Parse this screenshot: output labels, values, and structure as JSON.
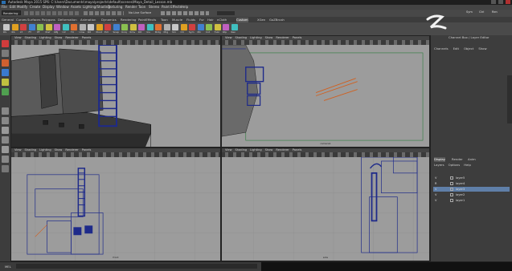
{
  "window": {
    "title": "Autodesk Maya 2015 SP6: C:\\Users\\Documents\\maya\\projects\\default\\scenes\\Maya_Detail_Lesson.mb"
  },
  "menubar": {
    "items": [
      "File",
      "Edit",
      "Modify",
      "Create",
      "Display",
      "Window",
      "Assets",
      "Lighting/Shading",
      "Texturing",
      "Render",
      "Toon",
      "Stereo",
      "Paint Effects",
      "Help"
    ]
  },
  "statusline": {
    "mode": "Rendering",
    "field": "No Live Surface",
    "tabs": [
      "Sym",
      "Ctrl",
      "Ren"
    ]
  },
  "shelf": {
    "tabs": [
      "General",
      "Curves",
      "Surfaces",
      "Polygons",
      "Deformation",
      "Animation",
      "Dynamics",
      "Rendering",
      "PaintEffects",
      "Toon",
      "Muscle",
      "Fluids",
      "Fur",
      "Hair",
      "nCloth",
      "Custom",
      "XGen",
      "GoZBrush"
    ],
    "active_tab": "Custom",
    "buttons": [
      "RS",
      "RS",
      "LT",
      "FT",
      "PF",
      "Pref",
      "OBJ",
      "UV",
      "TX",
      "Unw",
      "Rlt",
      "Pivot",
      "Ext",
      "Snap",
      "Uniq",
      "Rmv",
      "Dlt",
      "Ins",
      "Brdg",
      "Mrg",
      "Shr",
      "Ctr",
      "Sym",
      "Mir",
      "Cnt",
      "Tvbl",
      "Rtp",
      "Ren"
    ],
    "button_colors": [
      "#c8c8c8",
      "#e0a020",
      "#d04040",
      "#4080d0",
      "#8ac050",
      "#d0c040",
      "#c060c0",
      "#40c0c0",
      "#e07030",
      "#b0b0b0"
    ]
  },
  "viewports": [
    {
      "menu": [
        "View",
        "Shading",
        "Lighting",
        "Show",
        "Renderer",
        "Panels"
      ],
      "label": ""
    },
    {
      "menu": [
        "View",
        "Shading",
        "Lighting",
        "Show",
        "Renderer",
        "Panels"
      ],
      "label": "camera1"
    },
    {
      "menu": [
        "View",
        "Shading",
        "Lighting",
        "Show",
        "Renderer",
        "Panels"
      ],
      "label": "front"
    },
    {
      "menu": [
        "View",
        "Shading",
        "Lighting",
        "Show",
        "Renderer",
        "Panels"
      ],
      "label": "side"
    }
  ],
  "channel_box": {
    "title": "Channel Box / Layer Editor",
    "menu": [
      "Channels",
      "Edit",
      "Object",
      "Show"
    ]
  },
  "layer_editor": {
    "tabs": [
      "Display",
      "Render",
      "Anim"
    ],
    "active_tab": "Display",
    "menu": [
      "Layers",
      "Options",
      "Help"
    ],
    "rows": [
      {
        "visible": "V",
        "name": "layer5",
        "selected": false
      },
      {
        "visible": "R",
        "name": "layer4",
        "selected": false
      },
      {
        "visible": "V",
        "name": "layer3",
        "selected": true
      },
      {
        "visible": "V",
        "name": "layer2",
        "selected": false
      },
      {
        "visible": "V",
        "name": "layer1",
        "selected": false
      }
    ]
  },
  "commandline": {
    "label": "MEL"
  },
  "colors": {
    "viewport_bg": "#9c9c9c",
    "wire_blue": "#1e2a8a",
    "wire_dark": "#1a1a1a",
    "selected_layer": "#5f7fa8"
  }
}
